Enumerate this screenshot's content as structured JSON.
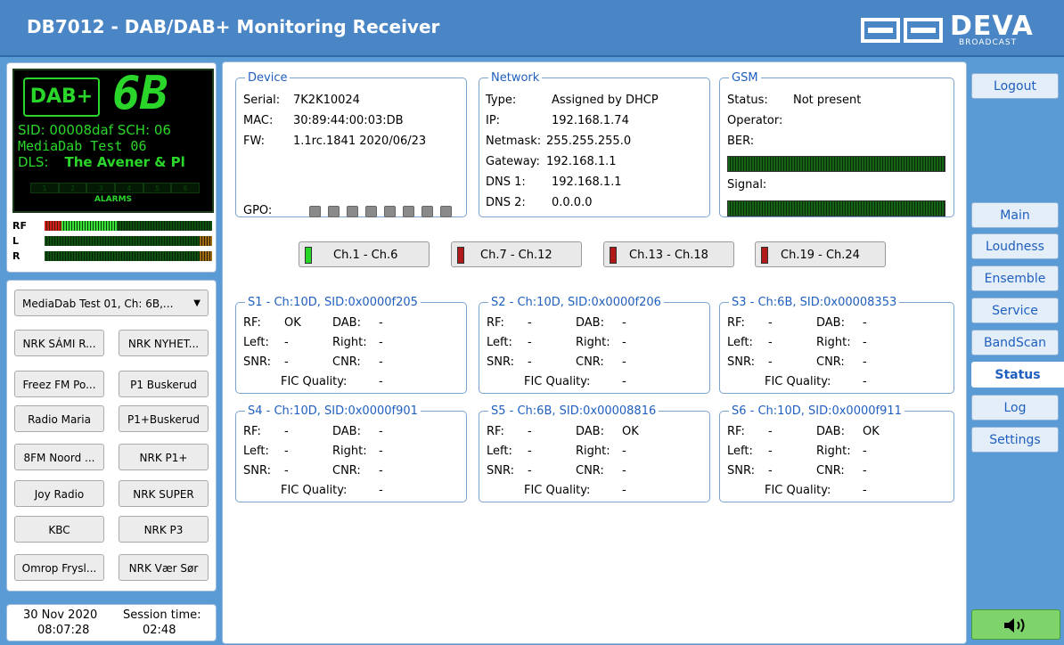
{
  "header": {
    "title": "DB7012 - DAB/DAB+ Monitoring Receiver",
    "logo_text": "DEVA",
    "logo_sub": "BROADCAST"
  },
  "lcd": {
    "logo": "DAB+",
    "channel": "6B",
    "sid_line": "SID: 00008daf  SCH: 06",
    "service_name": "MediaDab Test 06",
    "dls_label": "DLS:",
    "dls_value": "The Avener & Pl",
    "alarms": [
      "1",
      "2",
      "3",
      "4",
      "5",
      "6"
    ],
    "alarms_label": "ALARMS",
    "colors": {
      "lcd_green": "#2bd62b",
      "lcd_bg": "#000000"
    }
  },
  "meters": {
    "rf": {
      "label": "RF",
      "red_fraction": 0.1,
      "green_fraction": 0.33
    },
    "l": {
      "label": "L",
      "fraction": 1.0
    },
    "r": {
      "label": "R",
      "fraction": 1.0
    }
  },
  "presets": {
    "selected": "MediaDab Test 01, Ch: 6B,...",
    "buttons": [
      [
        "NRK SÁMI R...",
        "NRK NYHET..."
      ],
      [
        "Freez FM Po...",
        "P1 Buskerud"
      ],
      [
        "Radio Maria",
        "P1+Buskerud"
      ],
      [
        "8FM Noord ...",
        "NRK P1+"
      ],
      [
        "Joy Radio",
        "NRK SUPER"
      ],
      [
        "KBC",
        "NRK P3"
      ],
      [
        "Omrop Frysl...",
        "NRK Vær Sør"
      ]
    ]
  },
  "datetime": {
    "date": "30 Nov 2020",
    "time": "08:07:28",
    "session_label": "Session time:",
    "session_value": "02:48"
  },
  "device": {
    "legend": "Device",
    "serial_label": "Serial:",
    "serial": "7K2K10024",
    "mac_label": "MAC:",
    "mac": "30:89:44:00:03:DB",
    "fw_label": "FW:",
    "fw": "1.1rc.1841 2020/06/23",
    "gpo_label": "GPO:"
  },
  "network": {
    "legend": "Network",
    "type_label": "Type:",
    "type": "Assigned by DHCP",
    "ip_label": "IP:",
    "ip": "192.168.1.74",
    "netmask_label": "Netmask:",
    "netmask": "255.255.255.0",
    "gateway_label": "Gateway:",
    "gateway": "192.168.1.1",
    "dns1_label": "DNS 1:",
    "dns1": "192.168.1.1",
    "dns2_label": "DNS 2:",
    "dns2": "0.0.0.0"
  },
  "gsm": {
    "legend": "GSM",
    "status_label": "Status:",
    "status": "Not present",
    "operator_label": "Operator:",
    "ber_label": "BER:",
    "signal_label": "Signal:"
  },
  "channel_groups": [
    {
      "label": "Ch.1 - Ch.6",
      "led": "#27d627"
    },
    {
      "label": "Ch.7 - Ch.12",
      "led": "#b01a1a"
    },
    {
      "label": "Ch.13 - Ch.18",
      "led": "#b01a1a"
    },
    {
      "label": "Ch.19 - Ch.24",
      "led": "#b01a1a"
    }
  ],
  "services": [
    {
      "title": "S1 - Ch:10D, SID:0x0000f205",
      "rf": "OK",
      "dab": "-",
      "left": "-",
      "right": "-",
      "snr": "-",
      "cnr": "-",
      "fic": "-"
    },
    {
      "title": "S2 - Ch:10D, SID:0x0000f206",
      "rf": "-",
      "dab": "-",
      "left": "-",
      "right": "-",
      "snr": "-",
      "cnr": "-",
      "fic": "-"
    },
    {
      "title": "S3 - Ch:6B, SID:0x00008353",
      "rf": "-",
      "dab": "-",
      "left": "-",
      "right": "-",
      "snr": "-",
      "cnr": "-",
      "fic": "-"
    },
    {
      "title": "S4 - Ch:10D, SID:0x0000f901",
      "rf": "-",
      "dab": "-",
      "left": "-",
      "right": "-",
      "snr": "-",
      "cnr": "-",
      "fic": "-"
    },
    {
      "title": "S5 - Ch:6B, SID:0x00008816",
      "rf": "-",
      "dab": "OK",
      "left": "-",
      "right": "-",
      "snr": "-",
      "cnr": "-",
      "fic": "-"
    },
    {
      "title": "S6 - Ch:10D, SID:0x0000f911",
      "rf": "-",
      "dab": "OK",
      "left": "-",
      "right": "-",
      "snr": "-",
      "cnr": "-",
      "fic": "-"
    }
  ],
  "service_labels": {
    "rf": "RF:",
    "dab": "DAB:",
    "left": "Left:",
    "right": "Right:",
    "snr": "SNR:",
    "cnr": "CNR:",
    "fic": "FIC Quality:"
  },
  "nav": {
    "logout": "Logout",
    "items": [
      "Main",
      "Loudness",
      "Ensemble",
      "Service",
      "BandScan",
      "Status",
      "Log",
      "Settings"
    ],
    "active": "Status"
  },
  "audio_button": {
    "icon": "speaker-icon"
  }
}
